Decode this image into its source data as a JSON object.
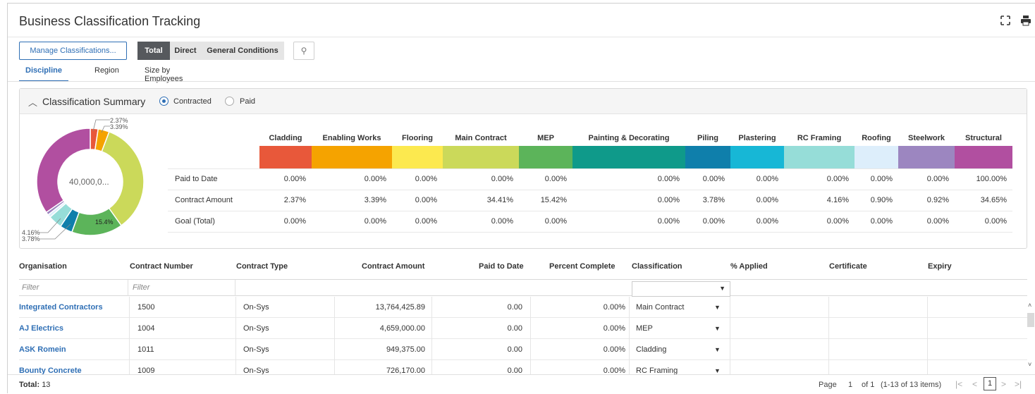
{
  "app": {
    "title": "Business Classification Tracking"
  },
  "toolbar": {
    "manage_label": "Manage Classifications...",
    "segments": [
      "Total",
      "Direct",
      "General Conditions"
    ],
    "active_segment": "Total"
  },
  "tabs": [
    "Discipline",
    "Region",
    "Size by Employees"
  ],
  "summary": {
    "title": "Classification Summary",
    "radio_contracted": "Contracted",
    "radio_paid": "Paid",
    "selected": "Contracted",
    "donut_center": "40,000,0...",
    "slice_labels": {
      "cladding": "2.37%",
      "enabling": "3.39%",
      "mep": "15.4%",
      "rc": "4.16%",
      "piling": "3.78%"
    },
    "columns": [
      "Cladding",
      "Enabling Works",
      "Flooring",
      "Main Contract",
      "MEP",
      "Painting & Decorating",
      "Piling",
      "Plastering",
      "RC Framing",
      "Roofing",
      "Steelwork",
      "Structural"
    ],
    "colors": [
      "#e8583a",
      "#f5a300",
      "#fce94f",
      "#cbd95a",
      "#5cb45a",
      "#0f9a8a",
      "#0f7fab",
      "#17b7d6",
      "#96ddd8",
      "#ddeefb",
      "#9c86c0",
      "#b14fa0"
    ],
    "rows": [
      {
        "label": "Paid to Date",
        "values": [
          "0.00%",
          "0.00%",
          "0.00%",
          "0.00%",
          "0.00%",
          "0.00%",
          "0.00%",
          "0.00%",
          "0.00%",
          "0.00%",
          "0.00%",
          "100.00%"
        ]
      },
      {
        "label": "Contract Amount",
        "values": [
          "2.37%",
          "3.39%",
          "0.00%",
          "34.41%",
          "15.42%",
          "0.00%",
          "3.78%",
          "0.00%",
          "4.16%",
          "0.90%",
          "0.92%",
          "34.65%"
        ]
      },
      {
        "label": "Goal (Total)",
        "values": [
          "0.00%",
          "0.00%",
          "0.00%",
          "0.00%",
          "0.00%",
          "0.00%",
          "0.00%",
          "0.00%",
          "0.00%",
          "0.00%",
          "0.00%",
          "0.00%"
        ]
      }
    ]
  },
  "chart_data": {
    "type": "pie",
    "categories": [
      "Cladding",
      "Enabling Works",
      "Flooring",
      "Main Contract",
      "MEP",
      "Painting & Decorating",
      "Piling",
      "Plastering",
      "RC Framing",
      "Roofing",
      "Steelwork",
      "Structural"
    ],
    "values": [
      2.37,
      3.39,
      0.0,
      34.41,
      15.42,
      0.0,
      3.78,
      0.0,
      4.16,
      0.9,
      0.92,
      34.65
    ]
  },
  "grid": {
    "headers": [
      "Organisation",
      "Contract Number",
      "Contract Type",
      "Contract Amount",
      "Paid to Date",
      "Percent Complete",
      "Classification",
      "% Applied",
      "Certificate",
      "Expiry"
    ],
    "filter_placeholder": "Filter",
    "rows": [
      {
        "org": "Integrated Contractors",
        "number": "1500",
        "type": "On-Sys",
        "amount": "13,764,425.89",
        "paid": "0.00",
        "pct": "0.00%",
        "class": "Main Contract"
      },
      {
        "org": "AJ Electrics",
        "number": "1004",
        "type": "On-Sys",
        "amount": "4,659,000.00",
        "paid": "0.00",
        "pct": "0.00%",
        "class": "MEP"
      },
      {
        "org": "ASK Romein",
        "number": "1011",
        "type": "On-Sys",
        "amount": "949,375.00",
        "paid": "0.00",
        "pct": "0.00%",
        "class": "Cladding"
      },
      {
        "org": "Bounty Concrete",
        "number": "1009",
        "type": "On-Sys",
        "amount": "726,170.00",
        "paid": "0.00",
        "pct": "0.00%",
        "class": "RC Framing"
      }
    ]
  },
  "footer": {
    "total_label": "Total:",
    "total_value": "13",
    "page_label": "Page",
    "page_num": "1",
    "of_label": "of 1",
    "items": "(1-13 of 13 items)"
  }
}
